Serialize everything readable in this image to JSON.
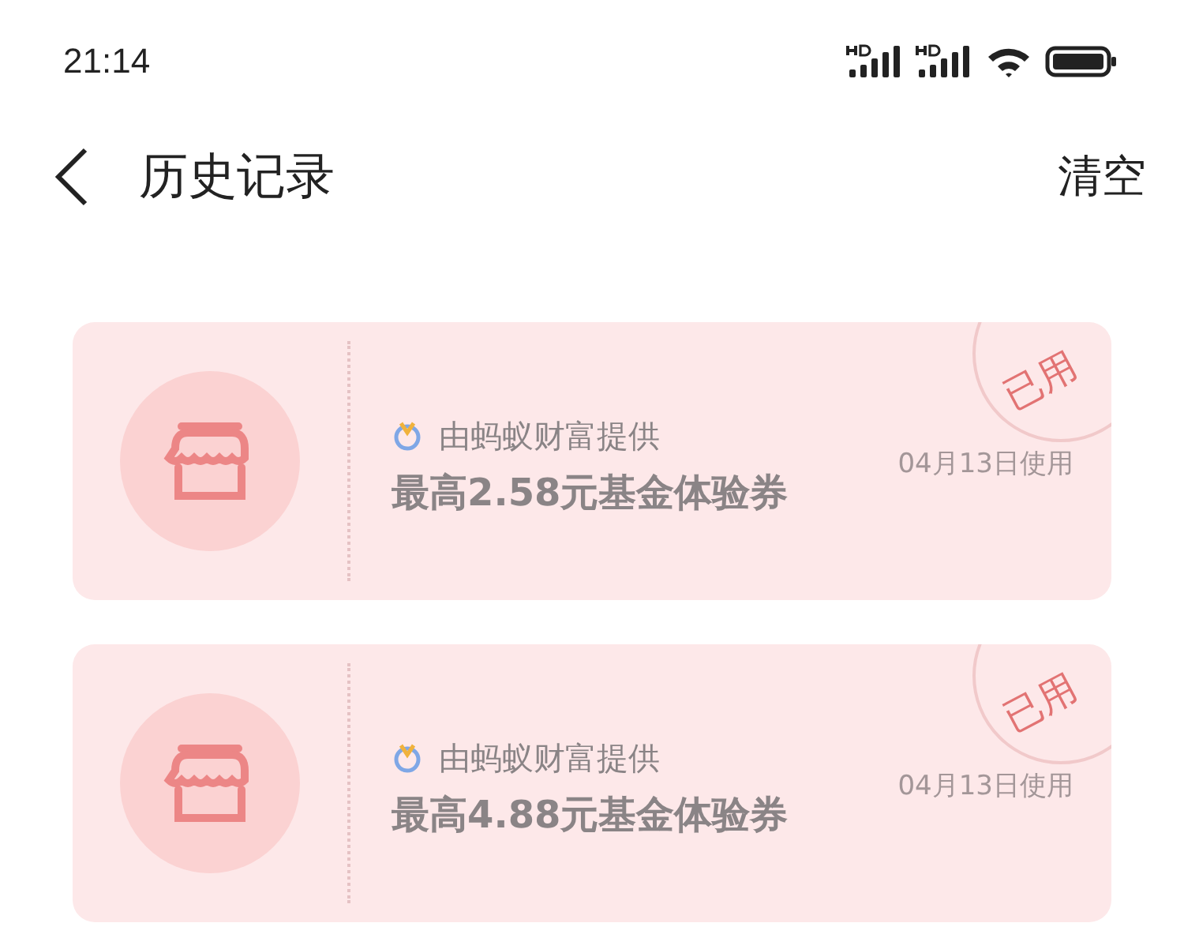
{
  "status_bar": {
    "time": "21:14"
  },
  "header": {
    "title": "历史记录",
    "action": "清空"
  },
  "coupons": [
    {
      "provider": "由蚂蚁财富提供",
      "title": "最高2.58元基金体验券",
      "date": "04月13日使用",
      "stamp": "已用"
    },
    {
      "provider": "由蚂蚁财富提供",
      "title": "最高4.88元基金体验券",
      "date": "04月13日使用",
      "stamp": "已用"
    }
  ]
}
